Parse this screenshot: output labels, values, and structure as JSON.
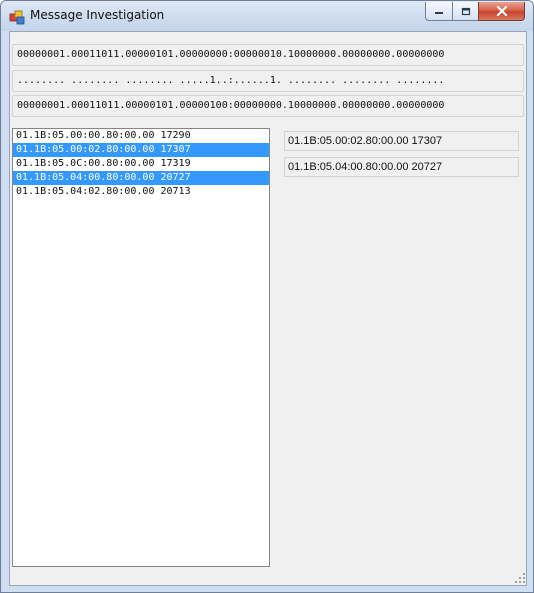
{
  "window": {
    "title": "Message Investigation"
  },
  "caption": {
    "minimize_icon": "minimize-icon",
    "maximize_icon": "maximize-icon",
    "close_icon": "close-icon"
  },
  "bit_rows": [
    "00000001.00011011.00000101.00000000:00000010.10000000.00000000.00000000",
    "........ ........ ........ .....1..:......1. ........ ........ ........",
    "00000001.00011011.00000101.00000100:00000000.10000000.00000000.00000000"
  ],
  "message_list": {
    "items": [
      {
        "text": "01.1B:05.00:00.80:00.00 17290",
        "selected": false
      },
      {
        "text": "01.1B:05.00:02.80:00.00 17307",
        "selected": true
      },
      {
        "text": "01.1B:05.0C:00.80:00.00 17319",
        "selected": false
      },
      {
        "text": "01.1B:05.04:00.80:00.00 20727",
        "selected": true
      },
      {
        "text": "01.1B:05.04:02.80:00.00 20713",
        "selected": false
      }
    ]
  },
  "selected_messages": [
    "01.1B:05.00:02.80:00.00 17307",
    "01.1B:05.04:00.80:00.00 20727"
  ],
  "colors": {
    "selection": "#3399ff",
    "close_button": "#c7432b"
  }
}
